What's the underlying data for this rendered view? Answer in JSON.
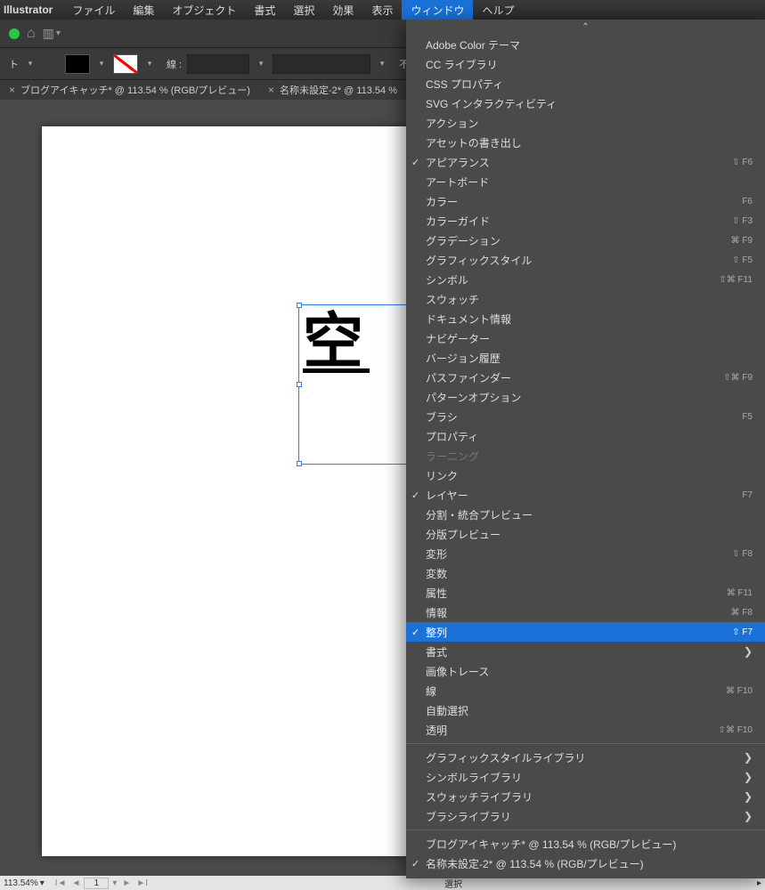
{
  "menubar": {
    "app": "Illustrator",
    "items": [
      "ファイル",
      "編集",
      "オブジェクト",
      "書式",
      "選択",
      "効果",
      "表示",
      "ウィンドウ",
      "ヘルプ"
    ],
    "active_index": 7
  },
  "toolbar2": {
    "stroke_label": "線 :",
    "opacity_label": "不透明"
  },
  "tabs": [
    {
      "close": "×",
      "label": "ブログアイキャッチ* @ 113.54 % (RGB/プレビュー)"
    },
    {
      "close": "×",
      "label": "名称未設定-2* @ 113.54 %"
    }
  ],
  "canvas": {
    "glyph": "空"
  },
  "statusbar": {
    "zoom": "113.54%",
    "page": "1",
    "mode": "選択"
  },
  "dropdown": {
    "top_chevron": "⌃",
    "groups": [
      [
        {
          "label": "Adobe Color テーマ"
        },
        {
          "label": "CC ライブラリ"
        },
        {
          "label": "CSS プロパティ"
        },
        {
          "label": "SVG インタラクティビティ"
        },
        {
          "label": "アクション"
        },
        {
          "label": "アセットの書き出し"
        },
        {
          "label": "アピアランス",
          "checked": true,
          "shortcut": "⇧ F6"
        },
        {
          "label": "アートボード"
        },
        {
          "label": "カラー",
          "shortcut": "F6"
        },
        {
          "label": "カラーガイド",
          "shortcut": "⇧ F3"
        },
        {
          "label": "グラデーション",
          "shortcut": "⌘ F9"
        },
        {
          "label": "グラフィックスタイル",
          "shortcut": "⇧ F5"
        },
        {
          "label": "シンボル",
          "shortcut": "⇧⌘ F11"
        },
        {
          "label": "スウォッチ"
        },
        {
          "label": "ドキュメント情報"
        },
        {
          "label": "ナビゲーター"
        },
        {
          "label": "バージョン履歴"
        },
        {
          "label": "パスファインダー",
          "shortcut": "⇧⌘ F9"
        },
        {
          "label": "パターンオプション"
        },
        {
          "label": "ブラシ",
          "shortcut": "F5"
        },
        {
          "label": "プロパティ"
        },
        {
          "label": "ラーニング",
          "disabled": true
        },
        {
          "label": "リンク"
        },
        {
          "label": "レイヤー",
          "checked": true,
          "shortcut": "F7"
        },
        {
          "label": "分割・統合プレビュー"
        },
        {
          "label": "分版プレビュー"
        },
        {
          "label": "変形",
          "shortcut": "⇧ F8"
        },
        {
          "label": "変数"
        },
        {
          "label": "属性",
          "shortcut": "⌘ F11"
        },
        {
          "label": "情報",
          "shortcut": "⌘ F8"
        },
        {
          "label": "整列",
          "checked": true,
          "highlighted": true,
          "shortcut": "⇧ F7"
        },
        {
          "label": "書式",
          "submenu": true
        },
        {
          "label": "画像トレース"
        },
        {
          "label": "線",
          "shortcut": "⌘ F10"
        },
        {
          "label": "自動選択"
        },
        {
          "label": "透明",
          "shortcut": "⇧⌘ F10"
        }
      ],
      [
        {
          "label": "グラフィックスタイルライブラリ",
          "submenu": true
        },
        {
          "label": "シンボルライブラリ",
          "submenu": true
        },
        {
          "label": "スウォッチライブラリ",
          "submenu": true
        },
        {
          "label": "ブラシライブラリ",
          "submenu": true
        }
      ],
      [
        {
          "label": "ブログアイキャッチ* @ 113.54 % (RGB/プレビュー)"
        },
        {
          "label": "名称未設定-2* @ 113.54 % (RGB/プレビュー)",
          "checked": true
        }
      ]
    ]
  }
}
